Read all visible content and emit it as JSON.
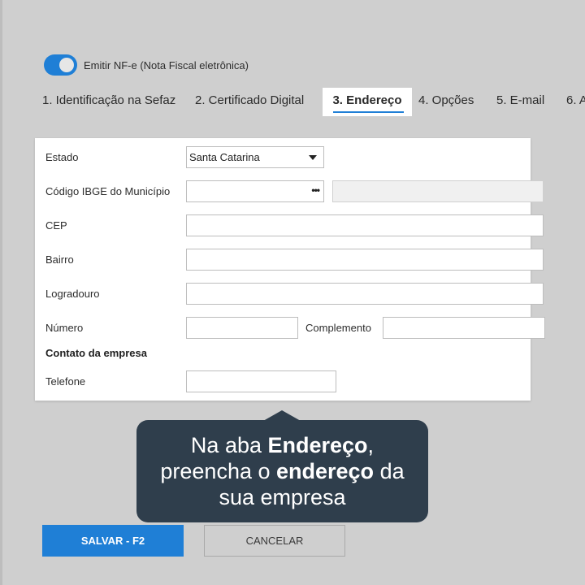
{
  "toggle": {
    "label": "Emitir NF-e (Nota Fiscal eletrônica)",
    "on": true
  },
  "tabs": [
    {
      "label": "1. Identificação na Sefaz"
    },
    {
      "label": "2. Certificado Digital"
    },
    {
      "label": "3. Endereço",
      "active": true
    },
    {
      "label": "4. Opções"
    },
    {
      "label": "5. E-mail"
    },
    {
      "label": "6. A"
    }
  ],
  "form": {
    "estado_label": "Estado",
    "estado_value": "Santa Catarina",
    "ibge_label": "Código IBGE do Município",
    "ibge_value": "",
    "ibge_lookup_glyph": "•••",
    "cep_label": "CEP",
    "bairro_label": "Bairro",
    "logradouro_label": "Logradouro",
    "numero_label": "Número",
    "complemento_label": "Complemento",
    "contato_title": "Contato da empresa",
    "telefone_label": "Telefone"
  },
  "callout": {
    "line1_pre": "Na aba ",
    "line1_bold": "Endereço",
    "line1_post": ",",
    "line2_pre": "preencha o ",
    "line2_bold": "endereço",
    "line2_post": " da",
    "line3": "sua empresa"
  },
  "buttons": {
    "save_label": "SALVAR - F2",
    "cancel_label": "CANCELAR"
  },
  "colors": {
    "accent": "#1f7fd6",
    "callout_bg": "#2f3e4c",
    "page_bg": "#cfcfcf"
  }
}
